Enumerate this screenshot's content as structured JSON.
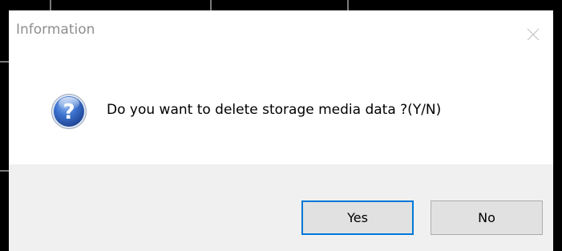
{
  "dialog": {
    "title": "Information",
    "message": "Do you want to delete storage media data ?(Y/N)",
    "icon": "question-icon"
  },
  "buttons": {
    "yes_label": "Yes",
    "no_label": "No"
  },
  "colors": {
    "backdrop": "#000000",
    "dialog_bg": "#ffffff",
    "footer_bg": "#f0f0f0",
    "title_text": "#8e8e8e",
    "button_bg": "#e1e1e1",
    "button_border": "#adadad",
    "focus_border": "#0078d7",
    "icon_blue": "#2a5db0"
  }
}
